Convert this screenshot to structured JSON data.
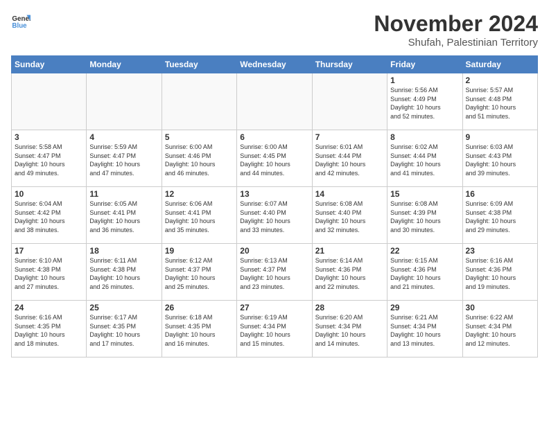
{
  "logo": {
    "line1": "General",
    "line2": "Blue"
  },
  "title": "November 2024",
  "location": "Shufah, Palestinian Territory",
  "weekdays": [
    "Sunday",
    "Monday",
    "Tuesday",
    "Wednesday",
    "Thursday",
    "Friday",
    "Saturday"
  ],
  "weeks": [
    [
      {
        "day": "",
        "info": ""
      },
      {
        "day": "",
        "info": ""
      },
      {
        "day": "",
        "info": ""
      },
      {
        "day": "",
        "info": ""
      },
      {
        "day": "",
        "info": ""
      },
      {
        "day": "1",
        "info": "Sunrise: 5:56 AM\nSunset: 4:49 PM\nDaylight: 10 hours\nand 52 minutes."
      },
      {
        "day": "2",
        "info": "Sunrise: 5:57 AM\nSunset: 4:48 PM\nDaylight: 10 hours\nand 51 minutes."
      }
    ],
    [
      {
        "day": "3",
        "info": "Sunrise: 5:58 AM\nSunset: 4:47 PM\nDaylight: 10 hours\nand 49 minutes."
      },
      {
        "day": "4",
        "info": "Sunrise: 5:59 AM\nSunset: 4:47 PM\nDaylight: 10 hours\nand 47 minutes."
      },
      {
        "day": "5",
        "info": "Sunrise: 6:00 AM\nSunset: 4:46 PM\nDaylight: 10 hours\nand 46 minutes."
      },
      {
        "day": "6",
        "info": "Sunrise: 6:00 AM\nSunset: 4:45 PM\nDaylight: 10 hours\nand 44 minutes."
      },
      {
        "day": "7",
        "info": "Sunrise: 6:01 AM\nSunset: 4:44 PM\nDaylight: 10 hours\nand 42 minutes."
      },
      {
        "day": "8",
        "info": "Sunrise: 6:02 AM\nSunset: 4:44 PM\nDaylight: 10 hours\nand 41 minutes."
      },
      {
        "day": "9",
        "info": "Sunrise: 6:03 AM\nSunset: 4:43 PM\nDaylight: 10 hours\nand 39 minutes."
      }
    ],
    [
      {
        "day": "10",
        "info": "Sunrise: 6:04 AM\nSunset: 4:42 PM\nDaylight: 10 hours\nand 38 minutes."
      },
      {
        "day": "11",
        "info": "Sunrise: 6:05 AM\nSunset: 4:41 PM\nDaylight: 10 hours\nand 36 minutes."
      },
      {
        "day": "12",
        "info": "Sunrise: 6:06 AM\nSunset: 4:41 PM\nDaylight: 10 hours\nand 35 minutes."
      },
      {
        "day": "13",
        "info": "Sunrise: 6:07 AM\nSunset: 4:40 PM\nDaylight: 10 hours\nand 33 minutes."
      },
      {
        "day": "14",
        "info": "Sunrise: 6:08 AM\nSunset: 4:40 PM\nDaylight: 10 hours\nand 32 minutes."
      },
      {
        "day": "15",
        "info": "Sunrise: 6:08 AM\nSunset: 4:39 PM\nDaylight: 10 hours\nand 30 minutes."
      },
      {
        "day": "16",
        "info": "Sunrise: 6:09 AM\nSunset: 4:38 PM\nDaylight: 10 hours\nand 29 minutes."
      }
    ],
    [
      {
        "day": "17",
        "info": "Sunrise: 6:10 AM\nSunset: 4:38 PM\nDaylight: 10 hours\nand 27 minutes."
      },
      {
        "day": "18",
        "info": "Sunrise: 6:11 AM\nSunset: 4:38 PM\nDaylight: 10 hours\nand 26 minutes."
      },
      {
        "day": "19",
        "info": "Sunrise: 6:12 AM\nSunset: 4:37 PM\nDaylight: 10 hours\nand 25 minutes."
      },
      {
        "day": "20",
        "info": "Sunrise: 6:13 AM\nSunset: 4:37 PM\nDaylight: 10 hours\nand 23 minutes."
      },
      {
        "day": "21",
        "info": "Sunrise: 6:14 AM\nSunset: 4:36 PM\nDaylight: 10 hours\nand 22 minutes."
      },
      {
        "day": "22",
        "info": "Sunrise: 6:15 AM\nSunset: 4:36 PM\nDaylight: 10 hours\nand 21 minutes."
      },
      {
        "day": "23",
        "info": "Sunrise: 6:16 AM\nSunset: 4:36 PM\nDaylight: 10 hours\nand 19 minutes."
      }
    ],
    [
      {
        "day": "24",
        "info": "Sunrise: 6:16 AM\nSunset: 4:35 PM\nDaylight: 10 hours\nand 18 minutes."
      },
      {
        "day": "25",
        "info": "Sunrise: 6:17 AM\nSunset: 4:35 PM\nDaylight: 10 hours\nand 17 minutes."
      },
      {
        "day": "26",
        "info": "Sunrise: 6:18 AM\nSunset: 4:35 PM\nDaylight: 10 hours\nand 16 minutes."
      },
      {
        "day": "27",
        "info": "Sunrise: 6:19 AM\nSunset: 4:34 PM\nDaylight: 10 hours\nand 15 minutes."
      },
      {
        "day": "28",
        "info": "Sunrise: 6:20 AM\nSunset: 4:34 PM\nDaylight: 10 hours\nand 14 minutes."
      },
      {
        "day": "29",
        "info": "Sunrise: 6:21 AM\nSunset: 4:34 PM\nDaylight: 10 hours\nand 13 minutes."
      },
      {
        "day": "30",
        "info": "Sunrise: 6:22 AM\nSunset: 4:34 PM\nDaylight: 10 hours\nand 12 minutes."
      }
    ]
  ]
}
